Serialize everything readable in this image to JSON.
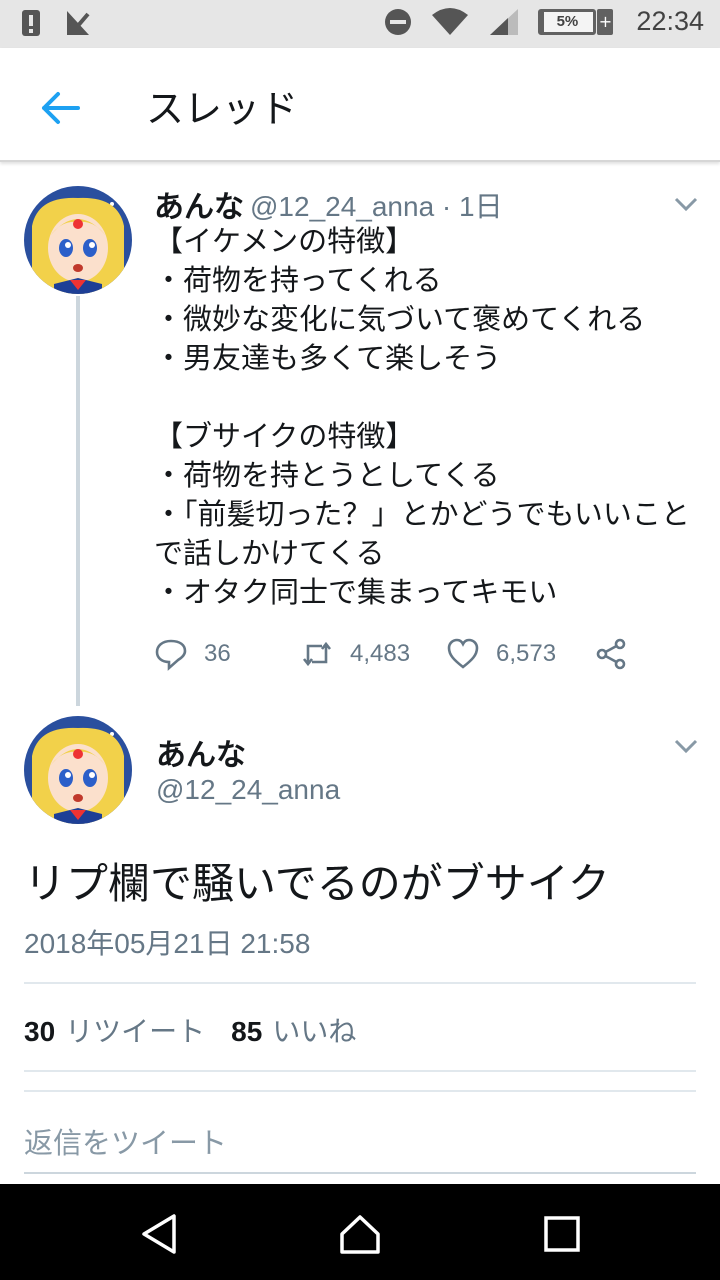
{
  "status_bar": {
    "battery_percent": "5%",
    "time": "22:34",
    "icons": [
      "alert-icon",
      "check-icon",
      "dnd-icon",
      "wifi-icon",
      "signal-icon",
      "battery-icon"
    ]
  },
  "header": {
    "title": "スレッド",
    "back_icon": "arrow-left-icon",
    "accent_color": "#1da1f2"
  },
  "tweet1": {
    "display_name": "あんな",
    "meta": "@12_24_anna · 1日",
    "body": "【イケメンの特徴】\n・荷物を持ってくれる\n・微妙な変化に気づいて褒めてくれる\n・男友達も多くて楽しそう\n\n【ブサイクの特徴】\n・荷物を持とうとしてくる\n・「前髪切った？」とかどうでもいいことで話しかけてくる\n・オタク同士で集まってキモい",
    "replies": "36",
    "retweets": "4,483",
    "likes": "6,573"
  },
  "tweet2": {
    "display_name": "あんな",
    "handle": "@12_24_anna",
    "body": "リプ欄で騒いでるのがブサイク",
    "date": "2018年05月21日 21:58",
    "retweet_count": "30",
    "retweet_label": "リツイート",
    "like_count": "85",
    "like_label": "いいね"
  },
  "reply_box": {
    "placeholder": "返信をツイート"
  },
  "nav_bar": {
    "icons": [
      "back-triangle-icon",
      "home-icon",
      "recents-icon"
    ]
  }
}
